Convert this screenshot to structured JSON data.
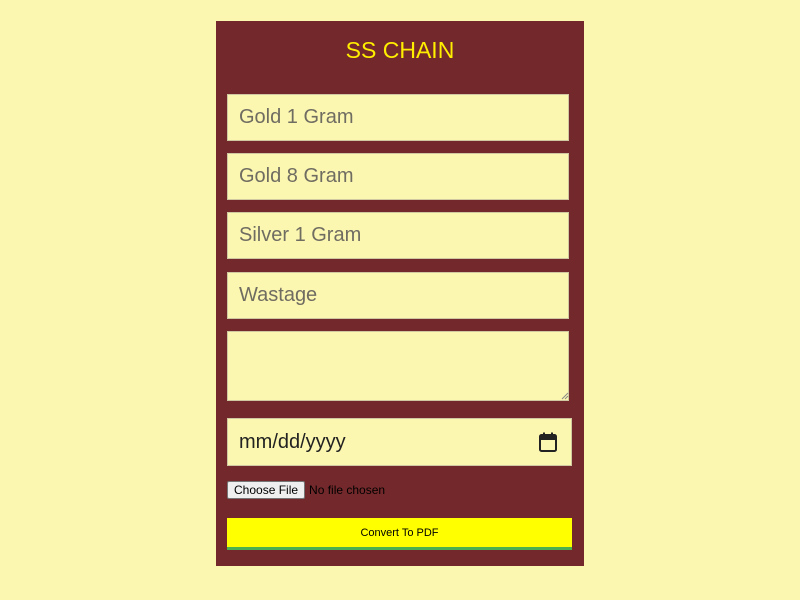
{
  "app": {
    "title": "SS CHAIN"
  },
  "form": {
    "gold_1_gram": {
      "value": "",
      "placeholder": "Gold 1 Gram"
    },
    "gold_8_gram": {
      "value": "",
      "placeholder": "Gold 8 Gram"
    },
    "silver_1_gram": {
      "value": "",
      "placeholder": "Silver 1 Gram"
    },
    "wastage": {
      "value": "",
      "placeholder": "Wastage"
    },
    "notes": {
      "value": "",
      "placeholder": ""
    },
    "date": {
      "display": "mm/dd/yyyy"
    },
    "file": {
      "button_label": "Choose File",
      "status": "No file chosen"
    },
    "convert_label": "Convert To PDF"
  },
  "colors": {
    "page_background": "#fcf7b0",
    "card_background": "#73292b",
    "title_color": "#ffee00",
    "convert_button": "#ffff00",
    "convert_underline": "#4caf50"
  },
  "icons": {
    "date_picker": "calendar-icon",
    "textarea_resize": "resize-grip-icon"
  }
}
